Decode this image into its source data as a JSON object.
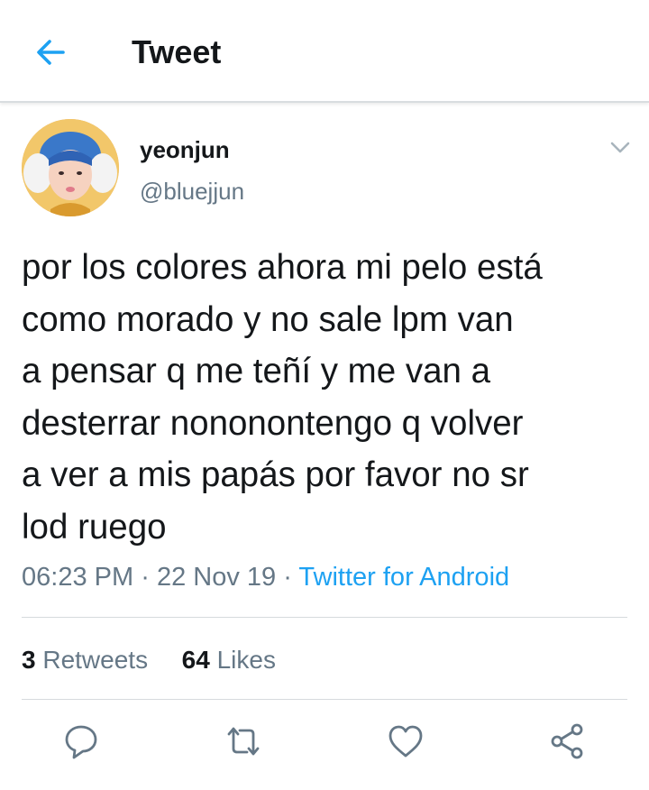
{
  "header": {
    "back_icon": "arrow-left-icon",
    "title": "Tweet",
    "accent_color": "#1da1f2"
  },
  "tweet": {
    "display_name": "yeonjun",
    "handle": "@bluejjun",
    "more_icon": "chevron-down-icon",
    "text": "por los colores ahora mi pelo está\ncomo morado y no sale lpm van\na pensar q me teñí y me van a\ndesterrar nononontengo q volver\na ver a mis papás por favor no sr\nlod ruego",
    "time": "06:23 PM",
    "date": "22 Nov 19",
    "separator": "·",
    "source": "Twitter for Android"
  },
  "stats": {
    "retweets_count": "3",
    "retweets_label": "Retweets",
    "likes_count": "64",
    "likes_label": "Likes"
  },
  "actions": [
    {
      "icon": "reply-icon"
    },
    {
      "icon": "retweet-icon"
    },
    {
      "icon": "like-icon"
    },
    {
      "icon": "share-icon"
    }
  ],
  "colors": {
    "text_primary": "#14171a",
    "text_secondary": "#657786",
    "link": "#1da1f2",
    "divider": "#d6dadd"
  }
}
